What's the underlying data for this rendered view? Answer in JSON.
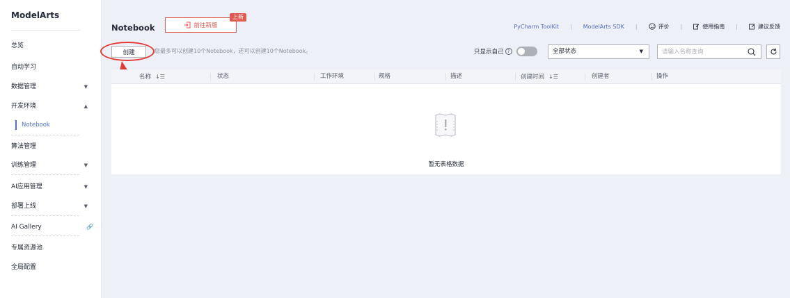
{
  "sidebar": {
    "brand": "ModelArts",
    "items": [
      {
        "label": "总览",
        "chevron": ""
      },
      {
        "label": "自动学习",
        "chevron": ""
      },
      {
        "label": "数据管理",
        "chevron": "▼"
      },
      {
        "label": "开发环境",
        "chevron": "▲"
      },
      {
        "label": "算法管理",
        "chevron": ""
      },
      {
        "label": "训练管理",
        "chevron": "▼"
      },
      {
        "label": "AI应用管理",
        "chevron": "▼"
      },
      {
        "label": "部署上线",
        "chevron": "▼"
      },
      {
        "label": "AI Gallery",
        "chevron": ""
      },
      {
        "label": "专属资源池",
        "chevron": ""
      },
      {
        "label": "全局配置",
        "chevron": ""
      }
    ],
    "sub_item": "Notebook"
  },
  "header": {
    "title": "Notebook",
    "new_version_label": "前往新版",
    "new_badge": "上新",
    "links": {
      "pycharm": "PyCharm ToolKit",
      "sdk": "ModelArts SDK",
      "rate": "评价",
      "guide": "使用指南",
      "feedback": "建议反馈"
    }
  },
  "toolbar": {
    "create_label": "创建",
    "hint": "您最多可以创建10个Notebook，还可以创建10个Notebook。",
    "only_mine": "只显示自己",
    "help_glyph": "?",
    "status_value": "全部状态",
    "search_placeholder": "请输入名称查询"
  },
  "table": {
    "columns": [
      "名称",
      "状态",
      "工作环境",
      "规格",
      "描述",
      "创建时间",
      "创建者",
      "操作"
    ],
    "empty_text": "暂无表格数据"
  },
  "colors": {
    "accent": "#526ecc",
    "danger": "#e05a52",
    "annotation": "#e53935"
  }
}
